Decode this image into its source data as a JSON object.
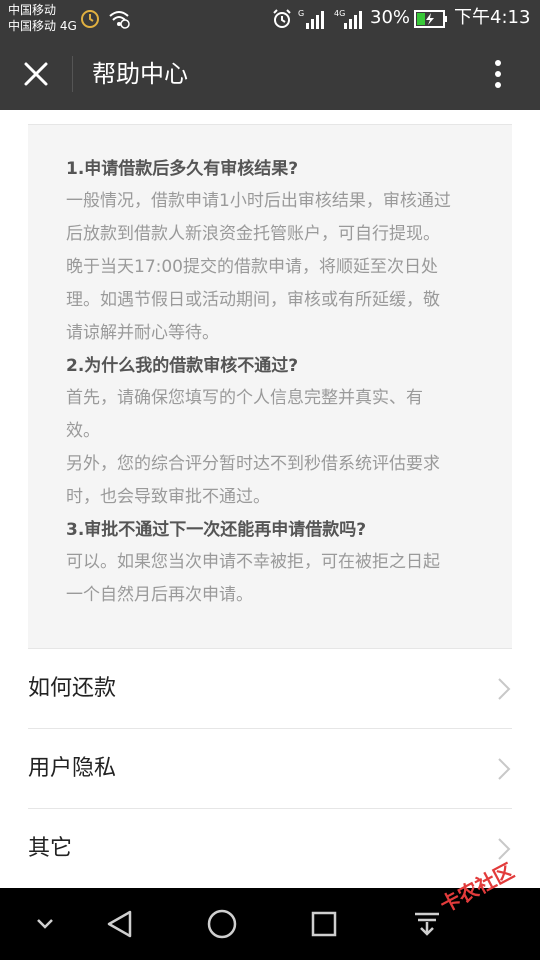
{
  "status_bar": {
    "carrier_1": "中国移动",
    "carrier_2": "中国移动 4G",
    "network_label": "4G",
    "battery_percent": "30%",
    "time": "下午4:13"
  },
  "app_bar": {
    "title": "帮助中心"
  },
  "faq": [
    {
      "question": "1.申请借款后多久有审核结果?",
      "answer_lines": [
        "一般情况，借款申请1小时后出审核结果，审核通过",
        "后放款到借款人新浪资金托管账户，可自行提现。",
        "晚于当天17:00提交的借款申请，将顺延至次日处",
        "理。如遇节假日或活动期间，审核或有所延缓，敬",
        "请谅解并耐心等待。"
      ]
    },
    {
      "question": "2.为什么我的借款审核不通过?",
      "answer_lines": [
        "首先，请确保您填写的个人信息完整并真实、有",
        "效。",
        "另外，您的综合评分暂时达不到秒借系统评估要求",
        "时，也会导致审批不通过。"
      ]
    },
    {
      "question": "3.审批不通过下一次还能再申请借款吗?",
      "answer_lines": [
        "可以。如果您当次申请不幸被拒，可在被拒之日起",
        "一个自然月后再次申请。"
      ]
    }
  ],
  "menu": [
    {
      "label": "如何还款"
    },
    {
      "label": "用户隐私"
    },
    {
      "label": "其它"
    }
  ],
  "watermark": "卡农社区",
  "colors": {
    "bar_bg": "#3a3a3a",
    "panel_bg": "#f5f5f5",
    "question_text": "#555555",
    "answer_text": "#9a9a9a",
    "watermark_red": "#e23b3b"
  }
}
